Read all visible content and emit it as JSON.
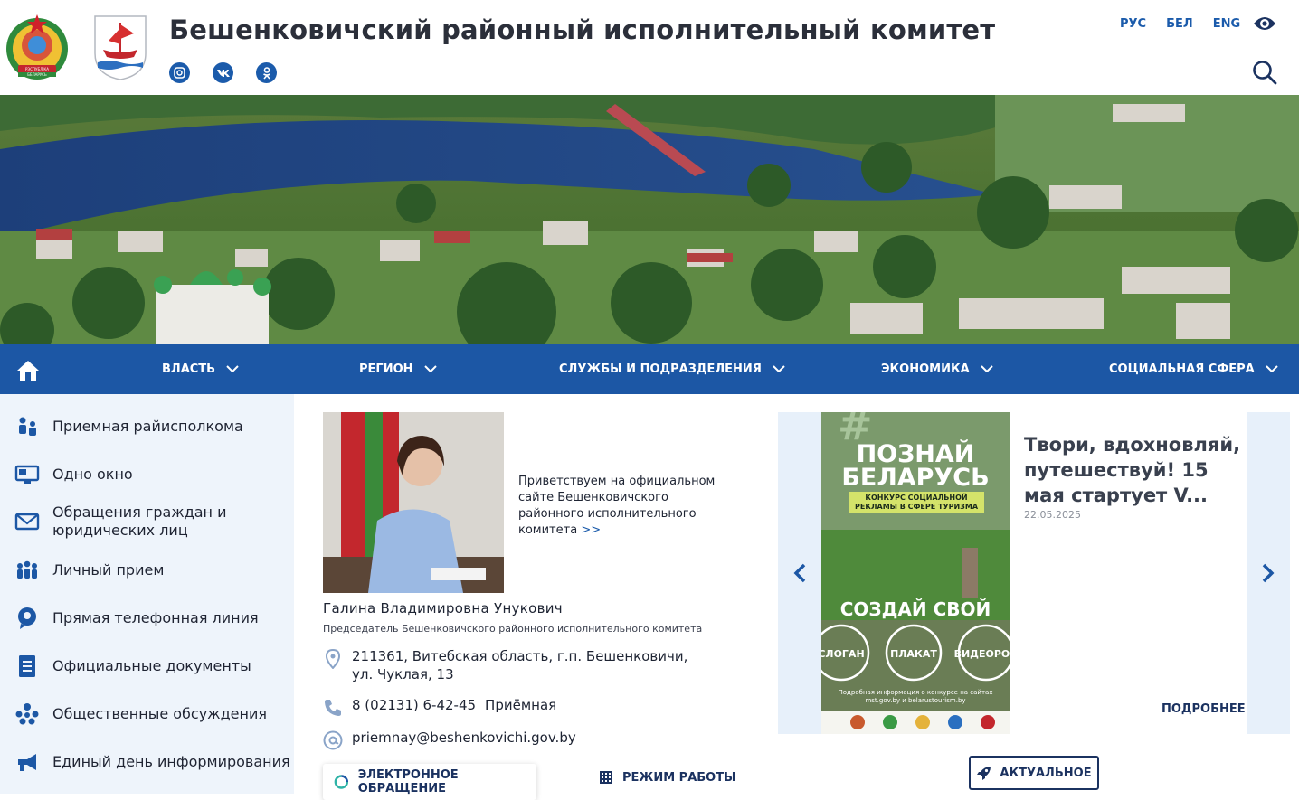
{
  "header": {
    "title": "Бешенковичский районный исполнительный комитет",
    "languages": [
      "РУС",
      "БЕЛ",
      "ENG"
    ],
    "emblem_text": "РЭСПУБЛІКА БЕЛАРУСЬ",
    "socials": [
      "instagram-icon",
      "vk-icon",
      "odnoklassniki-icon"
    ]
  },
  "nav": {
    "items": [
      "ВЛАСТЬ",
      "РЕГИОН",
      "СЛУЖБЫ И ПОДРАЗДЕЛЕНИЯ",
      "ЭКОНОМИКА",
      "СОЦИАЛЬНАЯ СФЕРА"
    ]
  },
  "sidebar": {
    "items": [
      {
        "label": "Приемная райисполкома"
      },
      {
        "label": "Одно окно"
      },
      {
        "label": "Обращения граждан и юридических лиц"
      },
      {
        "label": "Личный прием"
      },
      {
        "label": "Прямая телефонная линия"
      },
      {
        "label": "Официальные документы"
      },
      {
        "label": "Общественные обсуждения"
      },
      {
        "label": "Единый день информирования"
      }
    ]
  },
  "chairman": {
    "greeting": "Приветствуем на официальном сайте Бешенковичского районного исполнительного комитета",
    "greeting_link": ">>",
    "name": "Галина Владимировна Унукович",
    "role": "Председатель Бешенковичского районного исполнительного комитета",
    "address": "211361, Витебская область, г.п. Бешенковичи, ул. Чуклая, 13",
    "phone": "8 (02131) 6-42-45",
    "phone_label": "Приёмная",
    "email": "priemnay@beshenkovichi.gov.by"
  },
  "actions": {
    "e_appeal": "ЭЛЕКТРОННОЕ ОБРАЩЕНИЕ",
    "work_mode": "РЕЖИМ РАБОТЫ",
    "actual": "АКТУАЛЬНОЕ"
  },
  "news": {
    "title": "Твори, вдохновляй, путешествуй! 15 мая стартует V...",
    "date": "22.05.2025",
    "more": "ПОДРОБНЕЕ",
    "poster": {
      "line1": "ПОЗНАЙ",
      "line2": "БЕЛАРУСЬ",
      "subtitle": "КОНКУРС СОЦИАЛЬНОЙ РЕКЛАМЫ В СФЕРЕ ТУРИЗМА",
      "cta": "СОЗДАЙ СВОЙ",
      "circles": [
        "СЛОГАН",
        "ПЛАКАТ",
        "ВИДЕОРОЛ"
      ],
      "footer": "Подробная информация о конкурсе на сайтах mst.gov.by и belarustourism.by"
    }
  }
}
